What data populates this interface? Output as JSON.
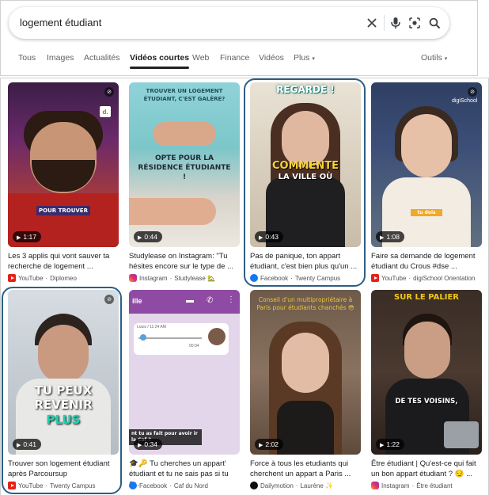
{
  "search": {
    "query": "logement étudiant"
  },
  "tabs": [
    {
      "label": "Tous"
    },
    {
      "label": "Images"
    },
    {
      "label": "Actualités"
    },
    {
      "label": "Vidéos courtes"
    },
    {
      "label": "Web"
    },
    {
      "label": "Finance"
    },
    {
      "label": "Vidéos"
    },
    {
      "label": "Plus"
    },
    {
      "label": "Outils"
    }
  ],
  "results": [
    {
      "duration": "1:17",
      "title": "Les 3 applis qui vont sauver ta recherche de logement ...",
      "source": "YouTube",
      "channel": "Diplomeo",
      "thumb_text": "POUR TROUVER",
      "thumb_logo": "d."
    },
    {
      "duration": "0:44",
      "title": "Studylease on Instagram: \"Tu hésites encore sur le type de ...",
      "source": "Instagram",
      "channel": "Studylease 🏡",
      "thumb_text_top": "TROUVER UN LOGEMENT ÉTUDIANT, C'EST GALÈRE?",
      "thumb_text_mid": "OPTE POUR LA RÉSIDENCE ÉTUDIANTE !"
    },
    {
      "duration": "0:43",
      "title": "Pas de panique, ton appart étudiant, c'est bien plus qu'un ...",
      "source": "Facebook",
      "channel": "Twenty Campus",
      "thumb_text_top": "REGARDE !",
      "thumb_text_mid": "COMMENTE",
      "thumb_text_low": "LA VILLE OÙ"
    },
    {
      "duration": "1:08",
      "title": "Faire sa demande de logement étudiant du Crous #dse ...",
      "source": "YouTube",
      "channel": "digiSchool Orientation",
      "thumb_logo": "digiSchool",
      "thumb_text": "tu dois"
    },
    {
      "duration": "0:41",
      "title": "Trouver son logement étudiant après Parcoursup",
      "source": "YouTube",
      "channel": "Twenty Campus",
      "thumb_text_top": "TU PEUX REVENIR",
      "thumb_text_mid": "PLUS"
    },
    {
      "duration": "0:34",
      "title": "🎓🔑 Tu cherches un appart' étudiant et tu ne sais pas si tu a...",
      "source": "Facebook",
      "channel": "Caf du Nord",
      "thumb_header": "ille",
      "thumb_chat_name": "Louis / 11:24 AM",
      "thumb_chat_time": "00:04",
      "thumb_text": "nt tu as fait pour avoir ir la Caf ?"
    },
    {
      "duration": "2:02",
      "title": "Force à tous les etudiants qui cherchent un appart a Paris ...",
      "source": "Dailymotion",
      "channel": "Laurène ✨",
      "thumb_text": "Conseil d'un multipropriétaire à Paris pour étudiants chanchés 😳"
    },
    {
      "duration": "1:22",
      "title": "Être étudiant | Qu'est-ce qui fait un bon appart étudiant ? 😏 ...",
      "source": "Instagram",
      "channel": "Être étudiant",
      "thumb_text_top": "SUR LE PALIER",
      "thumb_text": "DE TES VOISINS,"
    }
  ],
  "colors": {
    "highlight_ring": "#2c5f86",
    "youtube": "#e62117",
    "facebook": "#1877f2"
  }
}
